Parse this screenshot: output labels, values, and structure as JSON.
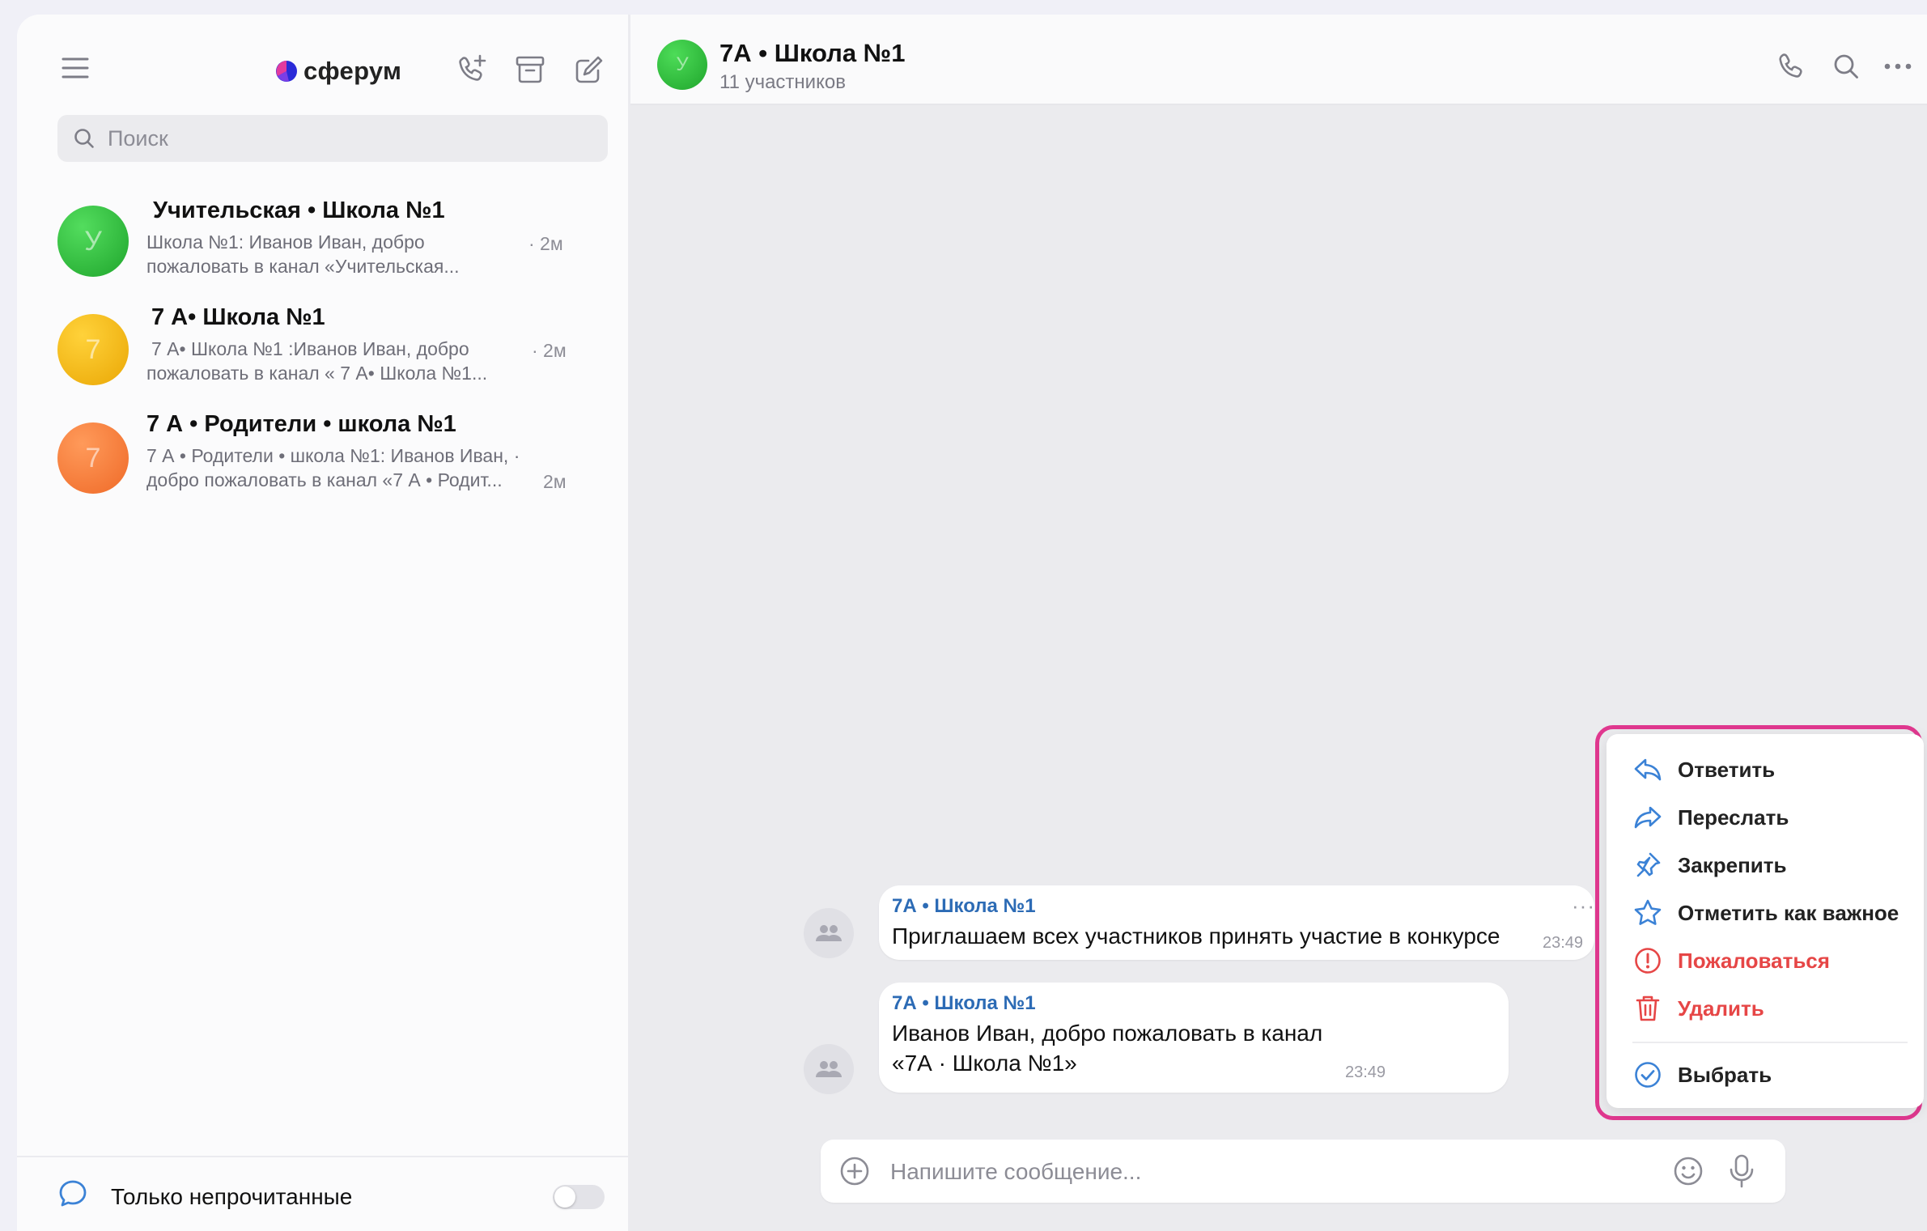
{
  "app": {
    "logo_text": "сферум"
  },
  "sidebar": {
    "search_placeholder": "Поиск",
    "chats": [
      {
        "title": "Учительская • Школа №1",
        "preview_line1": "Школа №1: Иванов Иван, добро",
        "preview_line2": "пожаловать в канал «Учительская...",
        "time": "· 2м",
        "avatar_letter": "У",
        "avatar_color": "#2fbf3a"
      },
      {
        "title": "7 А• Школа №1",
        "preview_line1": "7 А• Школа №1 :Иванов Иван, добро",
        "preview_line2": "пожаловать в канал « 7 А• Школа №1...",
        "time": "· 2м",
        "avatar_letter": "7",
        "avatar_color": "#f5b80f"
      },
      {
        "title": "7 А • Родители • школа №1",
        "preview_line1": "7 А • Родители • школа №1: Иванов Иван, ·",
        "preview_line2": "добро пожаловать в канал «7 А • Родит...",
        "time": "2м",
        "avatar_letter": "7",
        "avatar_color": "#f37a35"
      }
    ],
    "unread_only_label": "Только непрочитанные",
    "unread_only_enabled": false
  },
  "chat": {
    "header": {
      "title": "7А • Школа №1",
      "subtitle": "11 участников",
      "avatar_letter": "У"
    },
    "messages": [
      {
        "author": "7А • Школа №1",
        "text_lines": [
          "Приглашаем всех  участников принять участие в конкурсе"
        ],
        "time": "23:49"
      },
      {
        "author": "7А • Школа №1",
        "text_lines": [
          "Иванов Иван, добро пожаловать в канал",
          "«7А · Школа №1»"
        ],
        "time": "23:49"
      }
    ],
    "composer_placeholder": "Напишите сообщение..."
  },
  "context_menu": {
    "items": [
      {
        "label": "Ответить",
        "icon": "reply-icon",
        "danger": false
      },
      {
        "label": "Переслать",
        "icon": "forward-icon",
        "danger": false
      },
      {
        "label": "Закрепить",
        "icon": "pin-icon",
        "danger": false
      },
      {
        "label": "Отметить как важное",
        "icon": "star-icon",
        "danger": false
      },
      {
        "label": "Пожаловаться",
        "icon": "report-icon",
        "danger": true
      },
      {
        "label": "Удалить",
        "icon": "trash-icon",
        "danger": true
      },
      {
        "label": "Выбрать",
        "icon": "select-check-icon",
        "danger": false
      }
    ]
  },
  "colors": {
    "accent": "#2c6bb5",
    "icon_blue": "#3b82d6",
    "danger": "#e64646",
    "highlight": "#e0388f"
  }
}
